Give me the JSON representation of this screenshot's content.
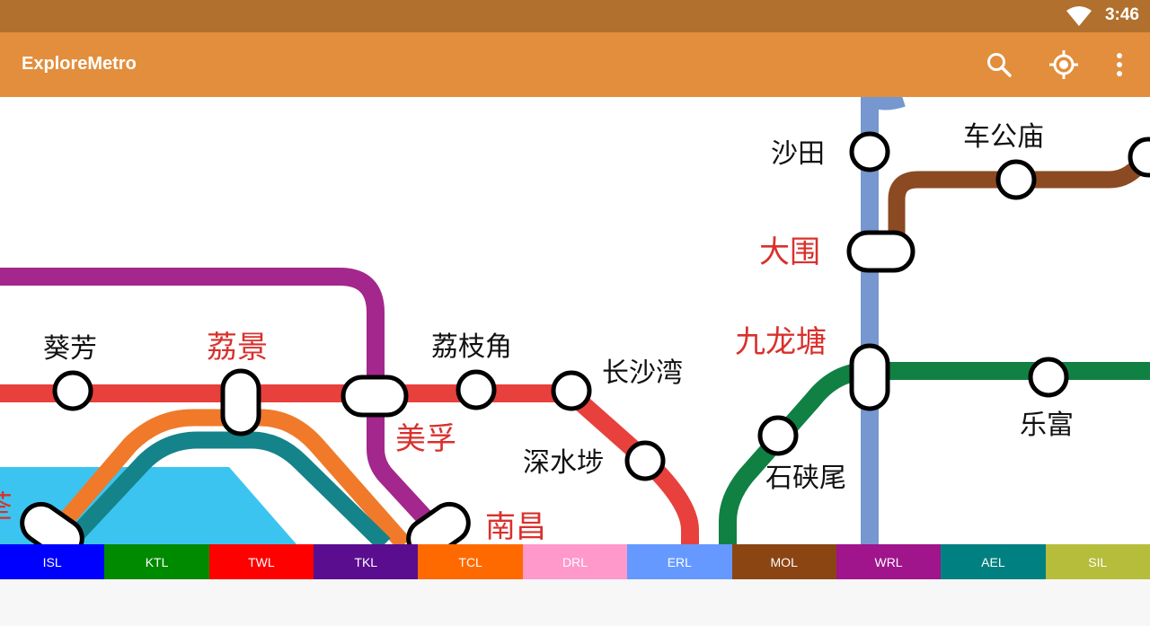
{
  "status_bar": {
    "time": "3:46"
  },
  "app_bar": {
    "title": "ExploreMetro",
    "actions": [
      "search-icon",
      "locate-icon",
      "more-vert-icon"
    ]
  },
  "map": {
    "stations": {
      "kwai_fong": "葵芳",
      "lai_king": "荔景",
      "lai_chi_kok": "荔枝角",
      "cheung_sha_wan": "长沙湾",
      "mei_foo": "美孚",
      "sham_shui_po": "深水埗",
      "nam_cheong": "南昌",
      "sha_tin": "沙田",
      "che_kung_temple": "车公庙",
      "tai_wai": "大围",
      "kowloon_tong": "九龙塘",
      "shek_kip_mei": "石硖尾",
      "lok_fu": "乐富",
      "partial_left": "荃"
    },
    "colors": {
      "tsuen_wan_line": "#e8403c",
      "tung_chung_line": "#f07a2a",
      "airport_express": "#15838a",
      "west_rail_line": "#a3278c",
      "east_rail_line": "#7697cf",
      "ma_on_shan_line": "#8b4a22",
      "kwun_tong_line": "#118043",
      "water": "#3cc4f0"
    }
  },
  "lines": [
    {
      "code": "ISL",
      "color": "#0000ff"
    },
    {
      "code": "KTL",
      "color": "#008a00"
    },
    {
      "code": "TWL",
      "color": "#ff0000"
    },
    {
      "code": "TKL",
      "color": "#5b0d90"
    },
    {
      "code": "TCL",
      "color": "#ff6a00"
    },
    {
      "code": "DRL",
      "color": "#ff99cc"
    },
    {
      "code": "ERL",
      "color": "#6699ff"
    },
    {
      "code": "MOL",
      "color": "#8b4513"
    },
    {
      "code": "WRL",
      "color": "#a0148c"
    },
    {
      "code": "AEL",
      "color": "#008080"
    },
    {
      "code": "SIL",
      "color": "#b5bd3a"
    }
  ]
}
